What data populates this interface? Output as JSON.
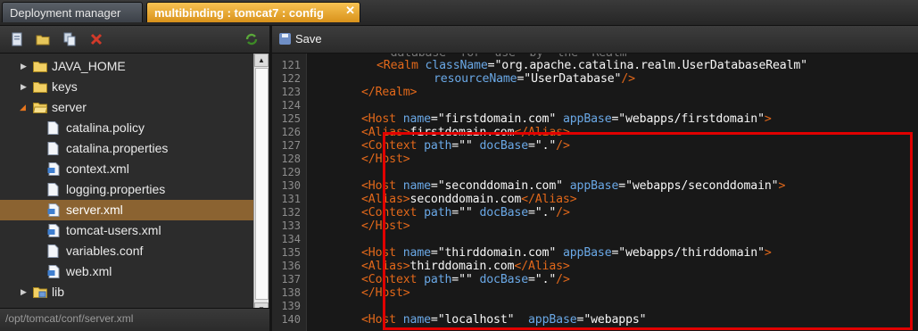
{
  "tabs": [
    {
      "label": "Deployment manager",
      "active": false
    },
    {
      "label": "multibinding : tomcat7 : config",
      "active": true
    }
  ],
  "tab_close_icon": "close-icon",
  "left_toolbar": {
    "icons": [
      "new-file-icon",
      "new-folder-icon",
      "copy-icon",
      "delete-icon",
      "refresh-icon"
    ]
  },
  "tree": [
    {
      "label": "JAVA_HOME",
      "icon": "folder-icon",
      "expanded": false
    },
    {
      "label": "keys",
      "icon": "folder-icon",
      "expanded": false
    },
    {
      "label": "server",
      "icon": "folder-icon",
      "expanded": true
    },
    {
      "label": "catalina.policy",
      "icon": "file-icon"
    },
    {
      "label": "catalina.properties",
      "icon": "file-icon"
    },
    {
      "label": "context.xml",
      "icon": "xml-file-icon"
    },
    {
      "label": "logging.properties",
      "icon": "file-icon"
    },
    {
      "label": "server.xml",
      "icon": "xml-file-icon",
      "selected": true
    },
    {
      "label": "tomcat-users.xml",
      "icon": "xml-file-icon"
    },
    {
      "label": "variables.conf",
      "icon": "file-icon"
    },
    {
      "label": "web.xml",
      "icon": "xml-file-icon"
    },
    {
      "label": "lib",
      "icon": "lib-folder-icon",
      "expanded": false
    }
  ],
  "status_path": "/opt/tomcat/conf/server.xml",
  "editor_toolbar": {
    "save_label": "Save"
  },
  "line_numbers": [
    "121",
    "122",
    "123",
    "124",
    "125",
    "126",
    "127",
    "128",
    "129",
    "130",
    "131",
    "132",
    "133",
    "134",
    "135",
    "136",
    "137",
    "138",
    "139",
    "140"
  ],
  "code_lines": [
    [
      [
        "tag",
        "<Realm "
      ],
      [
        "attr",
        "className"
      ],
      [
        "txt",
        "="
      ],
      [
        "str",
        "\"org.apache.catalina.realm.UserDatabaseRealm\""
      ]
    ],
    [
      [
        "attr",
        "resourceName"
      ],
      [
        "txt",
        "="
      ],
      [
        "str",
        "\"UserDatabase\""
      ],
      [
        "tag",
        "/>"
      ]
    ],
    [
      [
        "tag",
        "</Realm>"
      ]
    ],
    [],
    [
      [
        "tag",
        "<Host "
      ],
      [
        "attr",
        "name"
      ],
      [
        "txt",
        "="
      ],
      [
        "str",
        "\"firstdomain.com\""
      ],
      [
        "txt",
        " "
      ],
      [
        "attr",
        "appBase"
      ],
      [
        "txt",
        "="
      ],
      [
        "str",
        "\"webapps/firstdomain\""
      ],
      [
        "tag",
        ">"
      ]
    ],
    [
      [
        "tag",
        "<Alias>"
      ],
      [
        "txt",
        "firstdomain.com"
      ],
      [
        "tag",
        "</Alias>"
      ]
    ],
    [
      [
        "tag",
        "<Context "
      ],
      [
        "attr",
        "path"
      ],
      [
        "txt",
        "="
      ],
      [
        "str",
        "\"\""
      ],
      [
        "txt",
        " "
      ],
      [
        "attr",
        "docBase"
      ],
      [
        "txt",
        "="
      ],
      [
        "str",
        "\".\""
      ],
      [
        "tag",
        "/>"
      ]
    ],
    [
      [
        "tag",
        "</Host>"
      ]
    ],
    [],
    [
      [
        "tag",
        "<Host "
      ],
      [
        "attr",
        "name"
      ],
      [
        "txt",
        "="
      ],
      [
        "str",
        "\"seconddomain.com\""
      ],
      [
        "txt",
        " "
      ],
      [
        "attr",
        "appBase"
      ],
      [
        "txt",
        "="
      ],
      [
        "str",
        "\"webapps/seconddomain\""
      ],
      [
        "tag",
        ">"
      ]
    ],
    [
      [
        "tag",
        "<Alias>"
      ],
      [
        "txt",
        "seconddomain.com"
      ],
      [
        "tag",
        "</Alias>"
      ]
    ],
    [
      [
        "tag",
        "<Context "
      ],
      [
        "attr",
        "path"
      ],
      [
        "txt",
        "="
      ],
      [
        "str",
        "\"\""
      ],
      [
        "txt",
        " "
      ],
      [
        "attr",
        "docBase"
      ],
      [
        "txt",
        "="
      ],
      [
        "str",
        "\".\""
      ],
      [
        "tag",
        "/>"
      ]
    ],
    [
      [
        "tag",
        "</Host>"
      ]
    ],
    [],
    [
      [
        "tag",
        "<Host "
      ],
      [
        "attr",
        "name"
      ],
      [
        "txt",
        "="
      ],
      [
        "str",
        "\"thirddomain.com\""
      ],
      [
        "txt",
        " "
      ],
      [
        "attr",
        "appBase"
      ],
      [
        "txt",
        "="
      ],
      [
        "str",
        "\"webapps/thirddomain\""
      ],
      [
        "tag",
        ">"
      ]
    ],
    [
      [
        "tag",
        "<Alias>"
      ],
      [
        "txt",
        "thirddomain.com"
      ],
      [
        "tag",
        "</Alias>"
      ]
    ],
    [
      [
        "tag",
        "<Context "
      ],
      [
        "attr",
        "path"
      ],
      [
        "txt",
        "="
      ],
      [
        "str",
        "\"\""
      ],
      [
        "txt",
        " "
      ],
      [
        "attr",
        "docBase"
      ],
      [
        "txt",
        "="
      ],
      [
        "str",
        "\".\""
      ],
      [
        "tag",
        "/>"
      ]
    ],
    [
      [
        "tag",
        "</Host>"
      ]
    ],
    [],
    [
      [
        "tag",
        "<Host "
      ],
      [
        "attr",
        "name"
      ],
      [
        "txt",
        "="
      ],
      [
        "str",
        "\"localhost\""
      ],
      [
        "txt",
        "  "
      ],
      [
        "attr",
        "appBase"
      ],
      [
        "txt",
        "="
      ],
      [
        "str",
        "\"webapps\""
      ]
    ]
  ],
  "colors": {
    "tag": "#e2681a",
    "attr": "#6aa8e6",
    "string": "#f7f7f7",
    "highlight": "#e00000",
    "active_tab": "#f0a832",
    "selected_row": "#8b6331"
  }
}
